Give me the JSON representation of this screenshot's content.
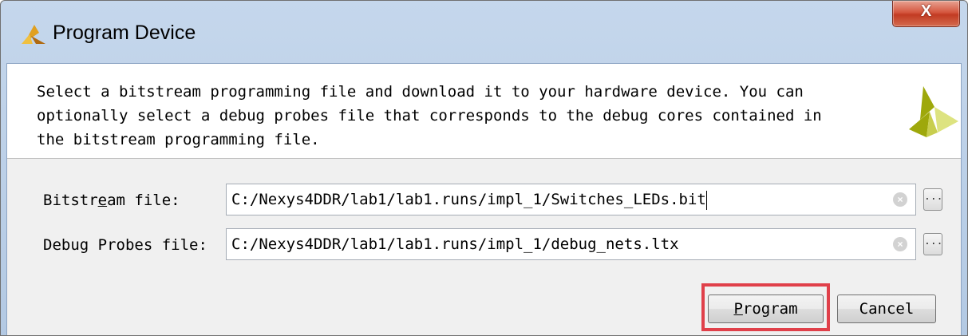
{
  "window": {
    "title": "Program Device",
    "close_glyph": "X"
  },
  "description": "Select a bitstream programming file and download it to your hardware device. You can\noptionally select a debug probes file that corresponds to the debug cores contained in\nthe bitstream programming file.",
  "icons": {
    "app": "xilinx-logo-icon",
    "header_logo": "xilinx-logo-icon",
    "clear": "clear-icon",
    "browse": "ellipsis-icon"
  },
  "form": {
    "bitstream": {
      "label_pre": "Bitstr",
      "label_mnemonic": "e",
      "label_post": "am file:",
      "value": "C:/Nexys4DDR/lab1/lab1.runs/impl_1/Switches_LEDs.bit"
    },
    "debug_probes": {
      "label": "Debug Probes file:",
      "value": "C:/Nexys4DDR/lab1/lab1.runs/impl_1/debug_nets.ltx"
    },
    "browse_label": "...",
    "clear_glyph": "×"
  },
  "buttons": {
    "program_mnemonic": "P",
    "program_rest": "rogram",
    "cancel": "Cancel"
  },
  "colors": {
    "highlight": "#e0404a",
    "close": "#c23b22",
    "logo_dark": "#9ea80b",
    "logo_light": "#dde380"
  }
}
